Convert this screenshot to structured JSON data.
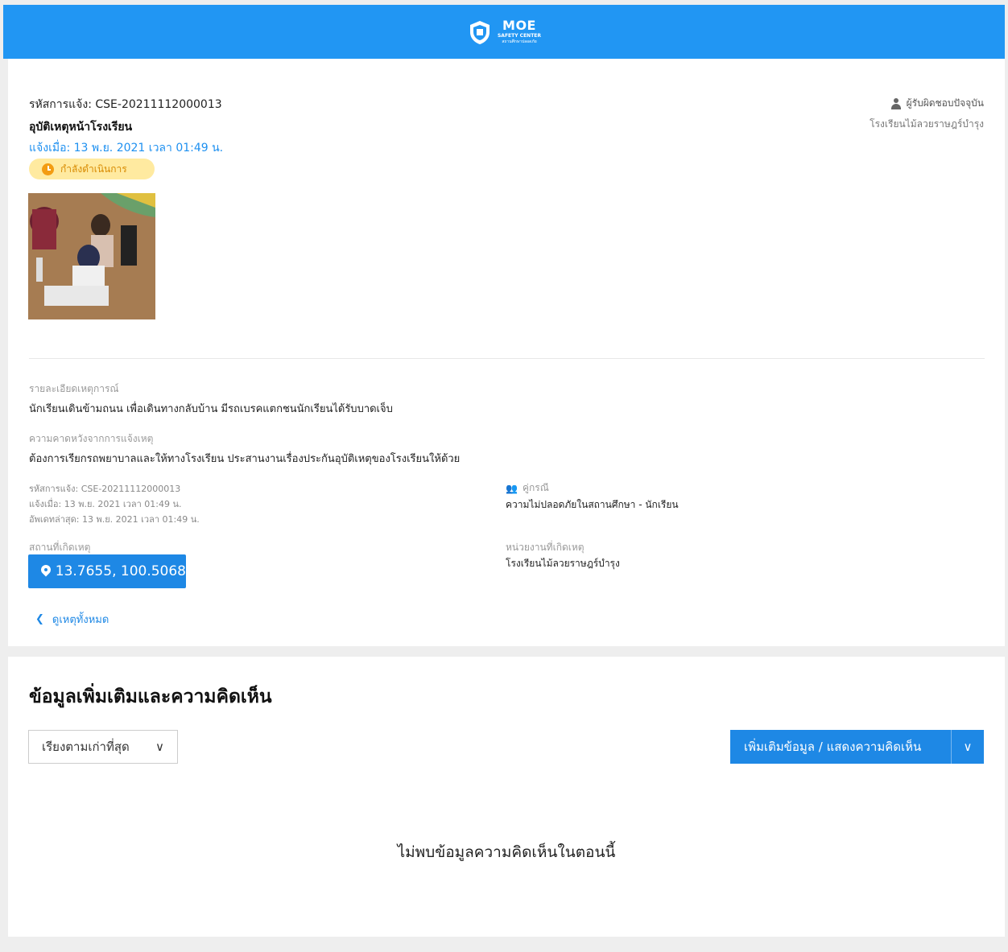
{
  "header": {
    "logo_main": "MOE",
    "logo_sub": "SAFETY CENTER",
    "logo_sub2": "สถานศึกษาปลอดภัย"
  },
  "case": {
    "code": "รหัสการแจ้ง: CSE-20211112000013",
    "title": "อุบัติเหตุหน้าโรงเรียน",
    "reported": "แจ้งเมื่อ: 13 พ.ย. 2021 เวลา 01:49 น.",
    "status": "กำลังดำเนินการ",
    "responsible_label": "ผู้รับผิดชอบปัจจุบัน",
    "responsible_name": "โรงเรียนไม้ลวยราษฎร์บำรุง"
  },
  "details": {
    "event_label": "รายละเอียดเหตุการณ์",
    "event_text": "นักเรียนเดินข้ามถนน เพื่อเดินทางกลับบ้าน มีรถเบรคแตกชนนักเรียนได้รับบาดเจ็บ",
    "expect_label": "ความคาดหวังจากการแจ้งเหตุ",
    "expect_text": "ต้องการเรียกรถพยาบาลและให้ทางโรงเรียน ประสานงานเรื่องประกันอุบัติเหตุของโรงเรียนให้ด้วย",
    "meta_code": "รหัสการแจ้ง: CSE-20211112000013",
    "meta_reported": "แจ้งเมื่อ: 13 พ.ย. 2021 เวลา 01:49 น.",
    "meta_updated": "อัพเดทล่าสุด: 13 พ.ย. 2021 เวลา 01:49 น.",
    "category_label": "คู่กรณี",
    "category_value": "ความไม่ปลอดภัยในสถานศึกษา - นักเรียน",
    "location_label": "สถานที่เกิดเหตุ",
    "location_value": "13.7655, 100.5068",
    "agency_label": "หน่วยงานที่เกิดเหตุ",
    "agency_value": "โรงเรียนไม้ลวยราษฎร์บำรุง",
    "back_label": "ดูเหตุทั้งหมด"
  },
  "comments": {
    "title": "ข้อมูลเพิ่มเติมและความคิดเห็น",
    "sort_label": "เรียงตามเก่าที่สุด",
    "add_label": "เพิ่มเติมข้อมูล / แสดงความคิดเห็น",
    "empty": "ไม่พบข้อมูลความคิดเห็นในตอนนี้"
  },
  "colors": {
    "primary": "#2196f3",
    "button": "#1e88e5",
    "status_bg": "#ffeaa0",
    "status_fg": "#d88a00"
  }
}
